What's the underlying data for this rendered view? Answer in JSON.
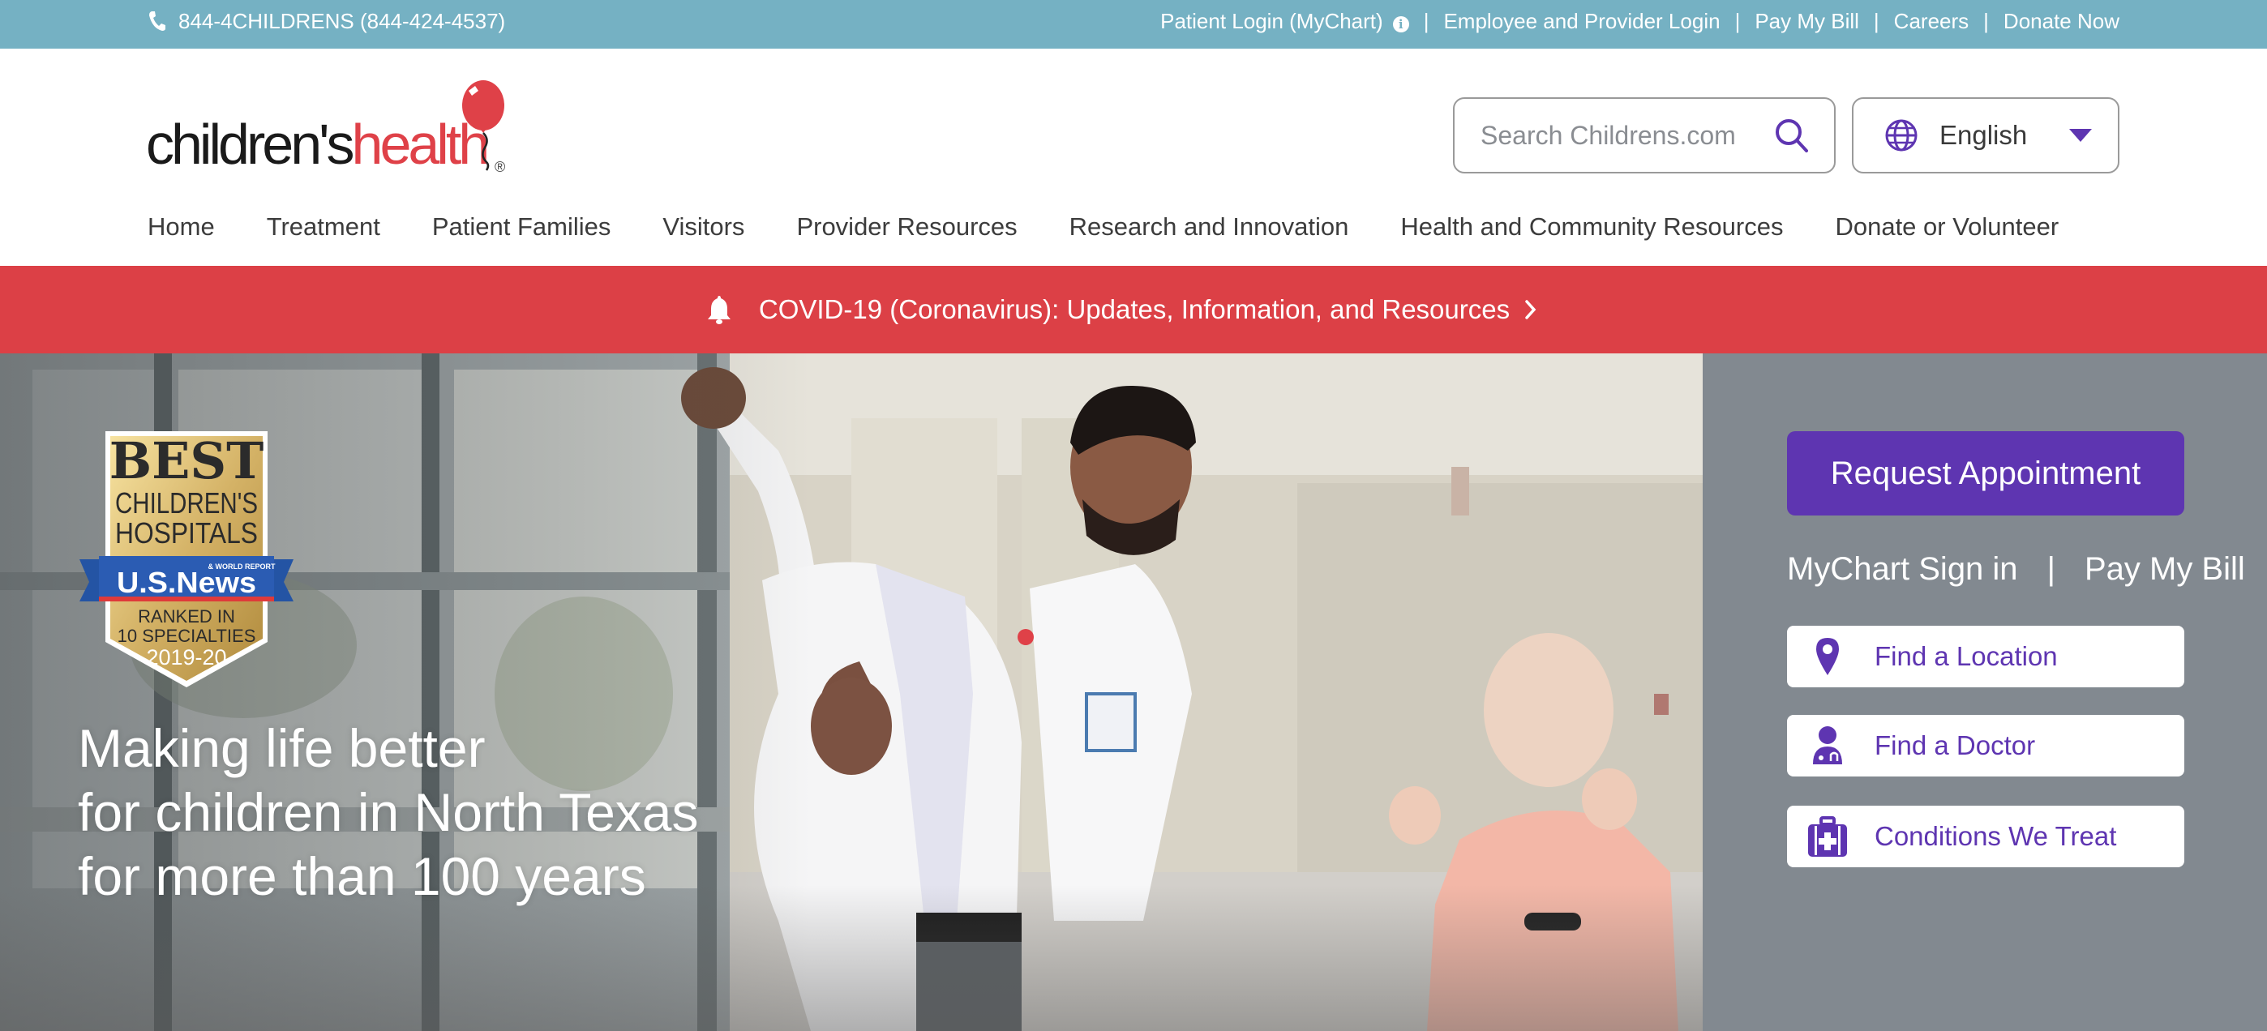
{
  "utility_bar": {
    "phone": "844-4CHILDRENS (844-424-4537)",
    "phone_icon": "phone-icon",
    "links": [
      {
        "label": "Patient Login (MyChart)",
        "icon": "info-icon"
      },
      {
        "label": "Employee and Provider Login"
      },
      {
        "label": "Pay My Bill"
      },
      {
        "label": "Careers"
      },
      {
        "label": "Donate Now"
      }
    ],
    "separator": "|",
    "info_glyph": "i"
  },
  "header": {
    "logo": {
      "part1": "children's",
      "part2": "health",
      "reg": "®"
    },
    "search": {
      "placeholder": "Search Childrens.com",
      "value": "",
      "icon": "search-icon"
    },
    "language": {
      "selected": "English",
      "icon": "globe-icon"
    },
    "nav": [
      {
        "label": "Home"
      },
      {
        "label": "Treatment"
      },
      {
        "label": "Patient Families"
      },
      {
        "label": "Visitors"
      },
      {
        "label": "Provider Resources"
      },
      {
        "label": "Research and Innovation"
      },
      {
        "label": "Health and Community Resources"
      },
      {
        "label": "Donate or Volunteer"
      }
    ]
  },
  "alert": {
    "icon": "bell-icon",
    "text": "COVID-19 (Coronavirus): Updates, Information, and Resources",
    "chevron": "chevron-right-icon"
  },
  "hero": {
    "badge": {
      "line1": "BEST",
      "line2": "CHILDREN'S",
      "line3": "HOSPITALS",
      "brand": "U.S.News",
      "brand_sub": "& WORLD REPORT",
      "ranked": "RANKED IN",
      "specialties": "10 SPECIALTIES",
      "years": "2019-20"
    },
    "headline": [
      "Making life better",
      "for children in North Texas",
      "for more than 100 years"
    ]
  },
  "side_panel": {
    "request_button": "Request Appointment",
    "quick_links": [
      {
        "label": "MyChart Sign in"
      },
      {
        "label": "Pay My Bill"
      }
    ],
    "separator": "|",
    "actions": [
      {
        "label": "Find a Location",
        "icon": "map-pin-icon"
      },
      {
        "label": "Find a Doctor",
        "icon": "doctor-icon"
      },
      {
        "label": "Conditions We Treat",
        "icon": "medical-kit-icon"
      }
    ]
  },
  "colors": {
    "utility_bar": "#75b1c3",
    "brand_red": "#dc4046",
    "brand_purple": "#5e35b1",
    "side_panel": "#828990"
  }
}
